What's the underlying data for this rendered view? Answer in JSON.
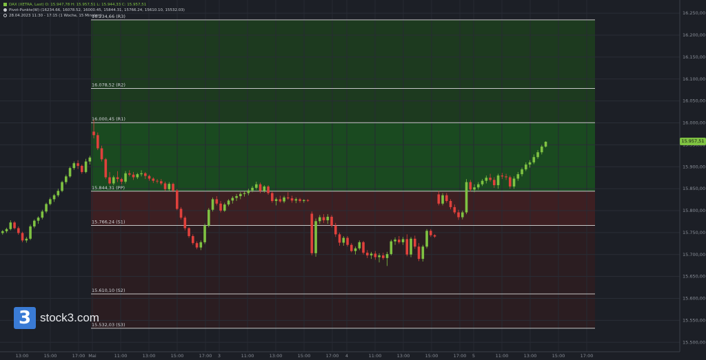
{
  "header": {
    "instrument_line": "DAX (XETRA, Last)   O: 15.947,78   H: 15.957,51   L: 15.944,33   C: 15.957,51",
    "pivot_line": "Pivot-Punkte(W)   (16234.66,   16078.52,   16000.45,   15844.31,   15766.24,   15610.10,   15532.03)",
    "period_line": "28.04.2023 11:30 - 17:15   (1 Woche, 15 Minuten)"
  },
  "branding": {
    "logo_mark": "3",
    "logo_text": "stock3.com"
  },
  "last_price_label": "15.957,51",
  "colors": {
    "background": "#1c1f26",
    "up": "#7fc242",
    "down": "#e0413c",
    "resistance_zone": "#1d3a1f",
    "resistance_zone_strong": "#1a4a20",
    "support_zone": "#3d1f22",
    "pivot_line": "#c8c8c8"
  },
  "chart_data": {
    "type": "candlestick",
    "y_axis": {
      "range": [
        15480,
        16280
      ],
      "ticks": [
        15500,
        15550,
        15600,
        15650,
        15700,
        15750,
        15800,
        15850,
        15900,
        15950,
        16000,
        16050,
        16100,
        16150,
        16200,
        16250
      ],
      "tick_labels": [
        "15.500,00",
        "15.550,00",
        "15.600,00",
        "15.650,00",
        "15.700,00",
        "15.750,00",
        "15.800,00",
        "15.850,00",
        "15.900,00",
        "15.950,00",
        "16.000,00",
        "16.050,00",
        "16.100,00",
        "16.150,00",
        "16.200,00",
        "16.250,00"
      ]
    },
    "x_axis": {
      "tick_labels": [
        "13:00",
        "15:00",
        "17:00",
        "Mai",
        "11:00",
        "13:00",
        "15:00",
        "17:00",
        "3",
        "11:00",
        "13:00",
        "15:00",
        "17:00",
        "4",
        "11:00",
        "13:00",
        "15:00",
        "17:00",
        "5",
        "11:00",
        "13:00",
        "15:00",
        "17:00"
      ]
    },
    "pivot_levels": [
      {
        "label": "16.234,66 (R3)",
        "value": 16234.66
      },
      {
        "label": "16.078,52 (R2)",
        "value": 16078.52
      },
      {
        "label": "16.000,45 (R1)",
        "value": 16000.45
      },
      {
        "label": "15.844,31 (PP)",
        "value": 15844.31
      },
      {
        "label": "15.766,24 (S1)",
        "value": 15766.24
      },
      {
        "label": "15.610,10 (S2)",
        "value": 15610.1
      },
      {
        "label": "15.532,03 (S3)",
        "value": 15532.03
      }
    ],
    "grid": true,
    "candles": [
      [
        15749,
        15756,
        15745,
        15753
      ],
      [
        15753,
        15761,
        15749,
        15758
      ],
      [
        15758,
        15778,
        15755,
        15773
      ],
      [
        15773,
        15776,
        15757,
        15760
      ],
      [
        15760,
        15764,
        15745,
        15749
      ],
      [
        15749,
        15752,
        15728,
        15732
      ],
      [
        15732,
        15740,
        15727,
        15736
      ],
      [
        15736,
        15768,
        15733,
        15764
      ],
      [
        15764,
        15780,
        15760,
        15777
      ],
      [
        15777,
        15787,
        15770,
        15784
      ],
      [
        15784,
        15802,
        15780,
        15798
      ],
      [
        15798,
        15818,
        15794,
        15815
      ],
      [
        15815,
        15830,
        15812,
        15826
      ],
      [
        15826,
        15838,
        15820,
        15835
      ],
      [
        15835,
        15850,
        15831,
        15845
      ],
      [
        15845,
        15868,
        15842,
        15865
      ],
      [
        15865,
        15882,
        15860,
        15878
      ],
      [
        15878,
        15900,
        15875,
        15897
      ],
      [
        15897,
        15912,
        15893,
        15908
      ],
      [
        15908,
        15915,
        15895,
        15902
      ],
      [
        15902,
        15905,
        15884,
        15888
      ],
      [
        15888,
        15918,
        15885,
        15912
      ],
      [
        15912,
        15925,
        15905,
        15921
      ],
      [
        15980,
        16007,
        15965,
        15972
      ],
      [
        15972,
        15978,
        15938,
        15942
      ],
      [
        15942,
        15948,
        15912,
        15917
      ],
      [
        15917,
        15920,
        15872,
        15876
      ],
      [
        15876,
        15888,
        15859,
        15862
      ],
      [
        15862,
        15880,
        15858,
        15876
      ],
      [
        15876,
        15890,
        15865,
        15872
      ],
      [
        15872,
        15875,
        15860,
        15866
      ],
      [
        15866,
        15890,
        15862,
        15885
      ],
      [
        15885,
        15892,
        15878,
        15882
      ],
      [
        15882,
        15888,
        15870,
        15876
      ],
      [
        15876,
        15886,
        15872,
        15883
      ],
      [
        15883,
        15892,
        15878,
        15885
      ],
      [
        15885,
        15888,
        15872,
        15879
      ],
      [
        15879,
        15882,
        15868,
        15873
      ],
      [
        15873,
        15876,
        15863,
        15868
      ],
      [
        15868,
        15872,
        15862,
        15867
      ],
      [
        15867,
        15872,
        15858,
        15862
      ],
      [
        15862,
        15866,
        15845,
        15849
      ],
      [
        15849,
        15865,
        15845,
        15861
      ],
      [
        15861,
        15864,
        15842,
        15846
      ],
      [
        15846,
        15849,
        15801,
        15804
      ],
      [
        15804,
        15808,
        15780,
        15784
      ],
      [
        15784,
        15788,
        15755,
        15760
      ],
      [
        15760,
        15762,
        15738,
        15742
      ],
      [
        15742,
        15746,
        15722,
        15726
      ],
      [
        15726,
        15730,
        15712,
        15716
      ],
      [
        15716,
        15732,
        15710,
        15728
      ],
      [
        15728,
        15770,
        15724,
        15766
      ],
      [
        15766,
        15806,
        15762,
        15802
      ],
      [
        15802,
        15830,
        15798,
        15826
      ],
      [
        15826,
        15833,
        15812,
        15816
      ],
      [
        15816,
        15822,
        15796,
        15800
      ],
      [
        15800,
        15818,
        15797,
        15814
      ],
      [
        15814,
        15826,
        15810,
        15823
      ],
      [
        15823,
        15833,
        15816,
        15829
      ],
      [
        15829,
        15838,
        15822,
        15833
      ],
      [
        15833,
        15842,
        15826,
        15838
      ],
      [
        15838,
        15844,
        15832,
        15840
      ],
      [
        15840,
        15850,
        15835,
        15846
      ],
      [
        15846,
        15856,
        15842,
        15852
      ],
      [
        15852,
        15866,
        15848,
        15860
      ],
      [
        15860,
        15864,
        15840,
        15845
      ],
      [
        15845,
        15858,
        15841,
        15855
      ],
      [
        15855,
        15858,
        15836,
        15840
      ],
      [
        15840,
        15844,
        15818,
        15822
      ],
      [
        15822,
        15830,
        15812,
        15826
      ],
      [
        15826,
        15834,
        15818,
        15821
      ],
      [
        15821,
        15834,
        15817,
        15830
      ],
      [
        15830,
        15842,
        15825,
        15828
      ],
      [
        15828,
        15834,
        15818,
        15823
      ],
      [
        15823,
        15830,
        15817,
        15826
      ],
      [
        15826,
        15829,
        15818,
        15822
      ],
      [
        15822,
        15826,
        15818,
        15824
      ],
      [
        15824,
        15826,
        15820,
        15823
      ],
      [
        15793,
        15798,
        15698,
        15703
      ],
      [
        15703,
        15782,
        15695,
        15776
      ],
      [
        15776,
        15790,
        15770,
        15785
      ],
      [
        15785,
        15792,
        15772,
        15778
      ],
      [
        15778,
        15792,
        15770,
        15786
      ],
      [
        15786,
        15790,
        15762,
        15766
      ],
      [
        15766,
        15772,
        15740,
        15746
      ],
      [
        15746,
        15750,
        15720,
        15727
      ],
      [
        15727,
        15742,
        15720,
        15738
      ],
      [
        15738,
        15742,
        15718,
        15722
      ],
      [
        15722,
        15726,
        15705,
        15708
      ],
      [
        15708,
        15718,
        15700,
        15714
      ],
      [
        15714,
        15732,
        15710,
        15728
      ],
      [
        15728,
        15731,
        15700,
        15704
      ],
      [
        15704,
        15710,
        15692,
        15698
      ],
      [
        15698,
        15706,
        15690,
        15702
      ],
      [
        15702,
        15708,
        15688,
        15694
      ],
      [
        15694,
        15703,
        15682,
        15698
      ],
      [
        15698,
        15704,
        15688,
        15692
      ],
      [
        15692,
        15706,
        15674,
        15701
      ],
      [
        15701,
        15734,
        15698,
        15730
      ],
      [
        15730,
        15739,
        15722,
        15734
      ],
      [
        15734,
        15742,
        15724,
        15728
      ],
      [
        15728,
        15740,
        15722,
        15735
      ],
      [
        15735,
        15746,
        15696,
        15700
      ],
      [
        15700,
        15740,
        15694,
        15736
      ],
      [
        15736,
        15743,
        15713,
        15718
      ],
      [
        15718,
        15726,
        15685,
        15690
      ],
      [
        15690,
        15722,
        15684,
        15718
      ],
      [
        15718,
        15758,
        15714,
        15754
      ],
      [
        15754,
        15758,
        15740,
        15744
      ],
      [
        15744,
        15746,
        15738,
        15741
      ],
      [
        15837,
        15845,
        15812,
        15816
      ],
      [
        15816,
        15840,
        15812,
        15835
      ],
      [
        15835,
        15840,
        15818,
        15822
      ],
      [
        15822,
        15826,
        15803,
        15808
      ],
      [
        15808,
        15814,
        15792,
        15796
      ],
      [
        15796,
        15802,
        15779,
        15785
      ],
      [
        15785,
        15800,
        15780,
        15796
      ],
      [
        15796,
        15872,
        15792,
        15865
      ],
      [
        15865,
        15870,
        15844,
        15848
      ],
      [
        15848,
        15860,
        15842,
        15853
      ],
      [
        15853,
        15865,
        15848,
        15860
      ],
      [
        15860,
        15872,
        15856,
        15868
      ],
      [
        15868,
        15880,
        15862,
        15875
      ],
      [
        15875,
        15884,
        15866,
        15870
      ],
      [
        15870,
        15876,
        15852,
        15858
      ],
      [
        15858,
        15884,
        15850,
        15880
      ],
      [
        15880,
        15886,
        15872,
        15878
      ],
      [
        15878,
        15884,
        15870,
        15876
      ],
      [
        15876,
        15880,
        15850,
        15855
      ],
      [
        15855,
        15878,
        15850,
        15873
      ],
      [
        15873,
        15888,
        15868,
        15883
      ],
      [
        15883,
        15898,
        15878,
        15894
      ],
      [
        15894,
        15910,
        15890,
        15905
      ],
      [
        15905,
        15915,
        15898,
        15910
      ],
      [
        15910,
        15928,
        15906,
        15922
      ],
      [
        15922,
        15938,
        15918,
        15933
      ],
      [
        15933,
        15950,
        15928,
        15946
      ],
      [
        15946,
        15958,
        15944,
        15957
      ]
    ],
    "last_price": 15957.51
  }
}
